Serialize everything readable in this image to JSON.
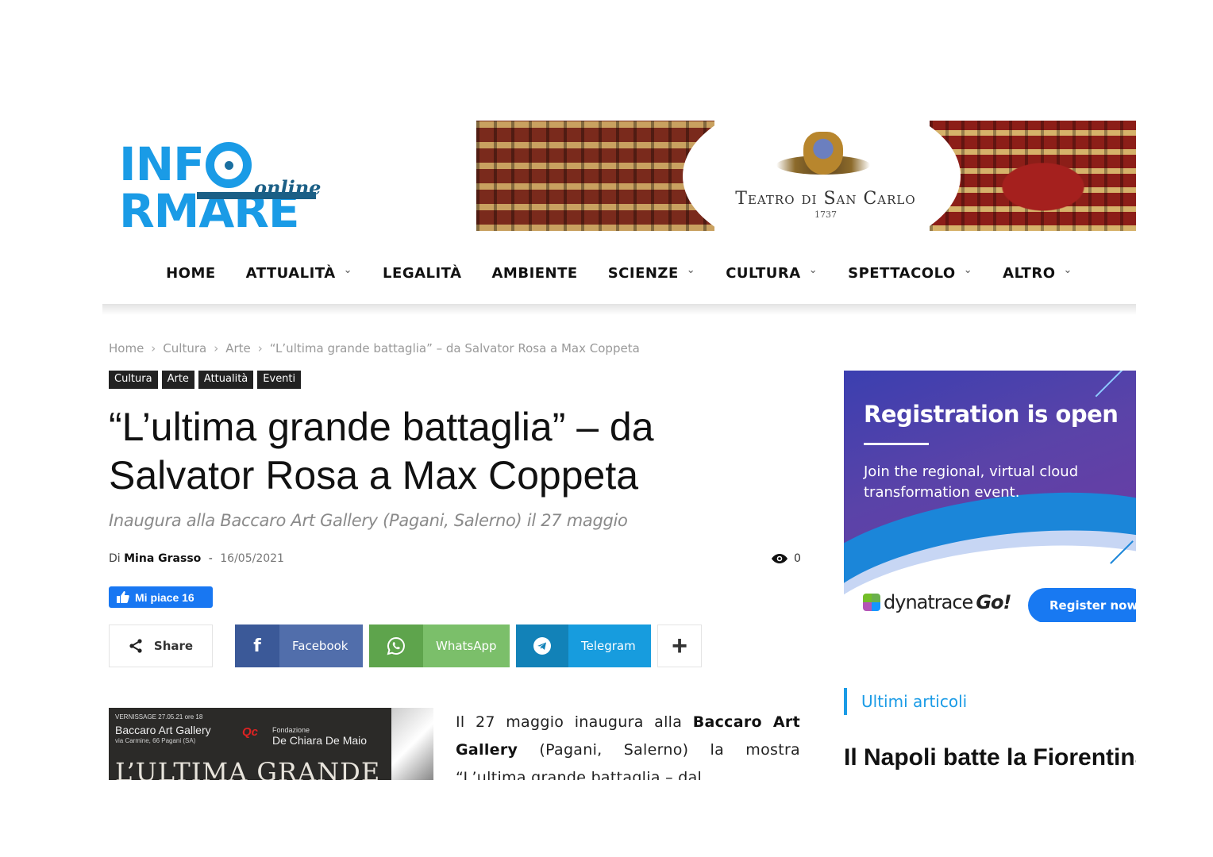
{
  "logo": {
    "text_before": "INF",
    "text_after": "RMARE",
    "sub": "online"
  },
  "banner": {
    "title": "Teatro di San Carlo",
    "year": "1737"
  },
  "nav": {
    "items": [
      {
        "label": "HOME",
        "has_menu": false
      },
      {
        "label": "ATTUALITÀ",
        "has_menu": true
      },
      {
        "label": "LEGALITÀ",
        "has_menu": false
      },
      {
        "label": "AMBIENTE",
        "has_menu": false
      },
      {
        "label": "SCIENZE",
        "has_menu": true
      },
      {
        "label": "CULTURA",
        "has_menu": true
      },
      {
        "label": "SPETTACOLO",
        "has_menu": true
      },
      {
        "label": "ALTRO",
        "has_menu": true
      }
    ]
  },
  "breadcrumb": [
    "Home",
    "Cultura",
    "Arte",
    "“L’ultima grande battaglia” – da Salvator Rosa a Max Coppeta"
  ],
  "tags": [
    "Cultura",
    "Arte",
    "Attualità",
    "Eventi"
  ],
  "article": {
    "title": "“L’ultima grande battaglia” – da Salvator Rosa a Max Coppeta",
    "subtitle": "Inaugura alla Baccaro Art Gallery (Pagani, Salerno) il 27 maggio",
    "by": "Di",
    "author": "Mina Grasso",
    "dash": "-",
    "date": "16/05/2021",
    "views": "0",
    "body_1": "Il 27 maggio inaugura alla ",
    "body_b1": "Baccaro Art Gallery",
    "body_2": " (Pagani, Salerno) la mostra “L’ultima grande battaglia – dal"
  },
  "like": {
    "label": "Mi piace 16"
  },
  "share": {
    "label": "Share",
    "facebook": "Facebook",
    "whatsapp": "WhatsApp",
    "telegram": "Telegram",
    "more": "+"
  },
  "article_image": {
    "vernissage": "VERNISSAGE 27.05.21 ore 18",
    "gallery": "Baccaro Art Gallery",
    "address": "via Carmine, 66 Pagani (SA)",
    "foundation": "Fondazione",
    "foundation_name": "De Chiara De Maio",
    "big": "L’ULTIMA GRANDE",
    "qc": "Qc"
  },
  "ad": {
    "heading": "Registration is open",
    "text": "Join the regional, virtual cloud transformation event.",
    "brand": "dynatrace",
    "brand_go": "Go!",
    "button": "Register now"
  },
  "latest": {
    "heading": "Ultimi articoli",
    "item": "Il Napoli batte la Fiorentina"
  }
}
